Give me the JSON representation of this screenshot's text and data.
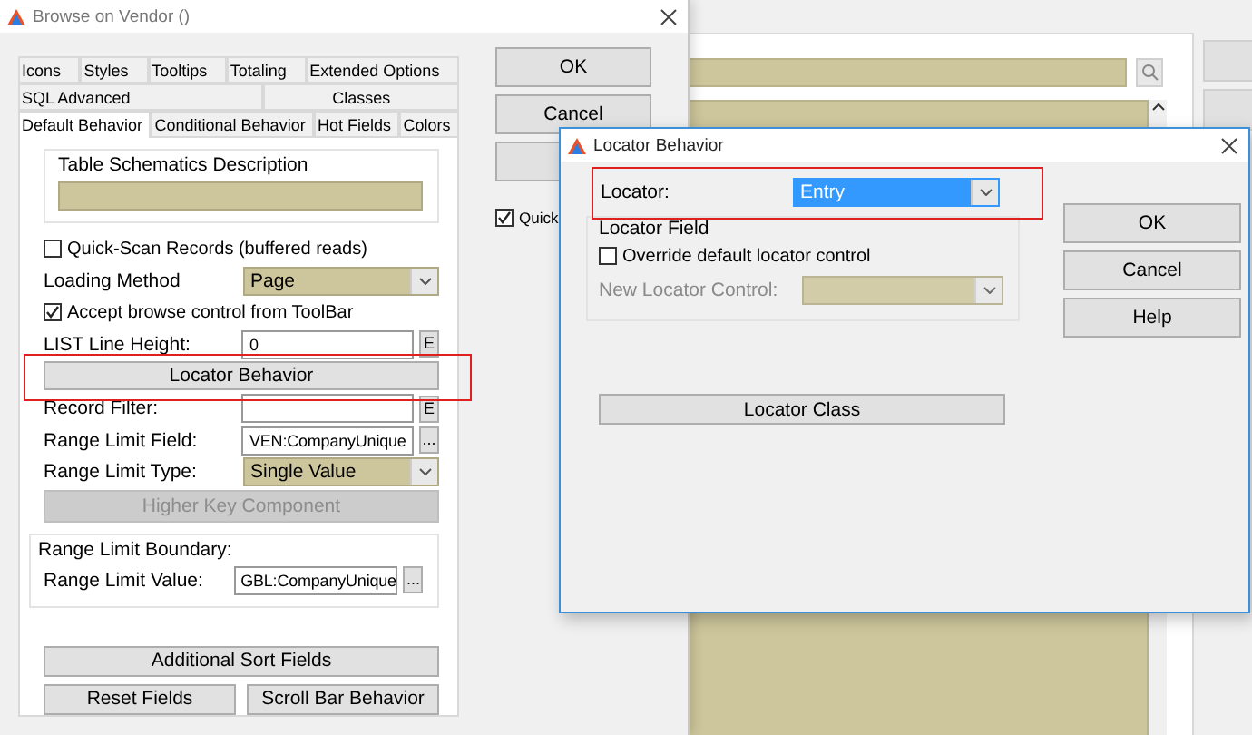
{
  "main_window": {
    "title": "Browse on Vendor ()",
    "tab_rows": [
      [
        {
          "label": "Icons",
          "selected": false
        },
        {
          "label": "Styles",
          "selected": false
        },
        {
          "label": "Tooltips",
          "selected": false
        },
        {
          "label": "Totaling",
          "selected": false
        },
        {
          "label": "Extended Options",
          "selected": false
        }
      ],
      [
        {
          "label": "SQL Advanced",
          "selected": false
        },
        {
          "label": "Classes",
          "selected": false
        }
      ],
      [
        {
          "label": "Default Behavior",
          "selected": true
        },
        {
          "label": "Conditional Behavior",
          "selected": false
        },
        {
          "label": "Hot Fields",
          "selected": false
        },
        {
          "label": "Colors",
          "selected": false
        }
      ]
    ],
    "schematics_group": {
      "title": "Table Schematics Description"
    },
    "rows": [
      {
        "kind": "checkbox",
        "label": "Quick-Scan Records (buffered reads)",
        "checked": false
      },
      {
        "kind": "combo",
        "label": "Loading Method",
        "value": "Page"
      },
      {
        "kind": "checkbox",
        "label": "Accept browse control from ToolBar",
        "checked": true
      },
      {
        "kind": "input",
        "label": "LIST Line Height:",
        "value": "0",
        "button": "E"
      },
      {
        "kind": "button",
        "label": "Locator Behavior",
        "disabled": false,
        "highlighted": true
      },
      {
        "kind": "input",
        "label": "Record Filter:",
        "value": "",
        "button": "E"
      },
      {
        "kind": "input",
        "label": "Range Limit Field:",
        "value": "VEN:CompanyUnique",
        "button": "..."
      },
      {
        "kind": "combo",
        "label": "Range Limit Type:",
        "value": "Single Value"
      },
      {
        "kind": "button",
        "label": "Higher Key Component",
        "disabled": true,
        "highlighted": false
      }
    ],
    "boundary_group": {
      "title": "Range Limit Boundary:",
      "label": "Range Limit Value:",
      "value": "GBL:CompanyUnique",
      "button": "..."
    },
    "bottom_buttons": [
      [
        "Additional Sort Fields"
      ],
      [
        "Reset Fields",
        "Scroll Bar Behavior"
      ]
    ],
    "side_buttons": [
      {
        "label": "OK"
      },
      {
        "label": "Cancel"
      }
    ],
    "side_checkbox": {
      "label": "Quick",
      "checked": true
    }
  },
  "locator_dialog": {
    "title": "Locator Behavior",
    "locator": {
      "label": "Locator:",
      "value": "Entry"
    },
    "group": {
      "title": "Locator Field",
      "checkbox": {
        "label": "Override default locator control",
        "checked": false
      },
      "control": {
        "label": "New Locator Control:",
        "disabled": true
      }
    },
    "class_button": "Locator Class",
    "buttons": [
      "OK",
      "Cancel",
      "Help"
    ]
  }
}
